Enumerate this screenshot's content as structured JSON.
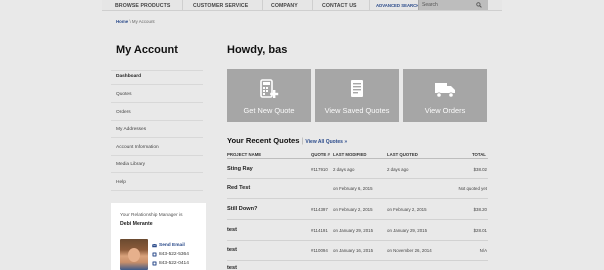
{
  "topnav": {
    "items": [
      "BROWSE PRODUCTS",
      "CUSTOMER SERVICE",
      "COMPANY",
      "CONTACT US"
    ],
    "advanced": "ADVANCED SEARCH",
    "search_placeholder": "Search"
  },
  "breadcrumb": {
    "home": "Home",
    "separator": "\\",
    "current": "My Account"
  },
  "sidebar": {
    "title": "My Account",
    "items": [
      {
        "label": "Dashboard",
        "active": true
      },
      {
        "label": "Quotes"
      },
      {
        "label": "Orders"
      },
      {
        "label": "My Addresses"
      },
      {
        "label": "Account Information"
      },
      {
        "label": "Media Library"
      },
      {
        "label": "Help"
      }
    ],
    "manager": {
      "label": "Your Relationship Manager is",
      "name": "Debi Merante",
      "email": "Send Email",
      "phones": [
        "843-522-5364",
        "843-522-0414"
      ]
    }
  },
  "main": {
    "greeting": "Howdy, bas",
    "tiles": [
      {
        "label": "Get New Quote",
        "icon": "calculator-plus-icon"
      },
      {
        "label": "View Saved Quotes",
        "icon": "document-list-icon"
      },
      {
        "label": "View Orders",
        "icon": "truck-icon"
      }
    ],
    "recent": {
      "title": "Your Recent Quotes",
      "view_all": "View All Quotes »",
      "headers": {
        "project": "PROJECT NAME",
        "quote": "QUOTE #",
        "modified": "LAST MODIFIED",
        "quoted": "LAST QUOTED",
        "total": "TOTAL"
      },
      "rows": [
        {
          "name": "Sting Ray",
          "quote": "#117910",
          "modified": "2 days ago",
          "quoted": "2 days ago",
          "total": "$38.02"
        },
        {
          "name": "Red Test",
          "quote": "",
          "modified": "on February 6, 2015",
          "quoted": "",
          "total": "Not quoted yet"
        },
        {
          "name": "Still Down?",
          "quote": "#114397",
          "modified": "on February 2, 2015",
          "quoted": "on February 2, 2015",
          "total": "$38.20"
        },
        {
          "name": "test",
          "quote": "#114191",
          "modified": "on January 29, 2015",
          "quoted": "on January 29, 2015",
          "total": "$28.01"
        },
        {
          "name": "test",
          "quote": "#110094",
          "modified": "on January 16, 2015",
          "quoted": "on November 26, 2014",
          "total": "N/A"
        },
        {
          "name": "test",
          "quote": "",
          "modified": "",
          "quoted": "",
          "total": ""
        }
      ]
    }
  }
}
